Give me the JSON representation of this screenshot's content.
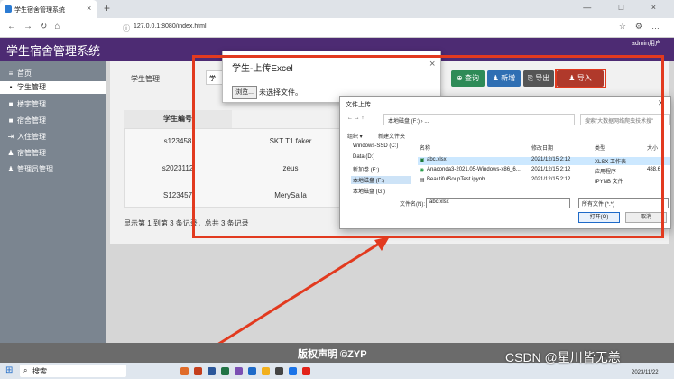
{
  "browser": {
    "tab_title": "学生宿舍管理系统",
    "tab_close": "×",
    "new_tab": "+",
    "url": "127.0.0.1:8080/index.html",
    "window_controls": "— □ ×"
  },
  "header": {
    "title": "学生宿舍管理系统",
    "user": "admin用户"
  },
  "sidebar": {
    "items": [
      {
        "icon": "≡",
        "label": "首页"
      },
      {
        "icon": "▪",
        "label": "学生管理"
      },
      {
        "icon": "■",
        "label": "楼宇管理"
      },
      {
        "icon": "■",
        "label": "宿舍管理"
      },
      {
        "icon": "⇥",
        "label": "入住管理"
      },
      {
        "icon": "♟",
        "label": "宿管管理"
      },
      {
        "icon": "♟",
        "label": "管理员管理"
      }
    ]
  },
  "main": {
    "filter_label": "学生管理",
    "filter_value": "学",
    "buttons": {
      "search": "查询",
      "add": "新增",
      "export": "导出",
      "import": "导入"
    },
    "table": {
      "header_number": "学生编号",
      "rows": [
        {
          "number": "s123458",
          "name": "SKT T1 faker"
        },
        {
          "number": "s2023112",
          "name": "zeus"
        },
        {
          "number": "S123457",
          "name": "MerySalla"
        }
      ]
    },
    "pagination": "显示第 1 到第 3 条记录，总共 3 条记录"
  },
  "upload_modal": {
    "title": "学生-上传Excel",
    "browse": "浏览...",
    "no_file": "未选择文件。",
    "close": "×"
  },
  "file_dialog": {
    "title": "文件上传",
    "path": "本地磁盘 (F:) › ...",
    "search_placeholder": "搜索\"大数据网络爬虫技术搜\"",
    "organize": "组织 ▾",
    "new_folder": "新建文件夹",
    "tree": [
      "Windows-SSD (C:)",
      "Data (D:)",
      "新加卷 (E:)",
      "本地磁盘 (F:)",
      "本地磁盘 (G:)"
    ],
    "columns": {
      "name": "名称",
      "date": "修改日期",
      "type": "类型",
      "size": "大小"
    },
    "files": [
      {
        "name": "abc.xlsx",
        "date": "2021/12/15 2:12",
        "type": "XLSX 工作表",
        "size": ""
      },
      {
        "name": "Anaconda3-2021.05-Windows-x86_6...",
        "date": "2021/12/15 2:12",
        "type": "应用程序",
        "size": "488,6"
      },
      {
        "name": "BeautifulSoupTest.ipynb",
        "date": "2021/12/15 2:12",
        "type": "IPYNB 文件",
        "size": ""
      }
    ],
    "filename_label": "文件名(N):",
    "filename_value": "abc.xlsx",
    "filetype_value": "所有文件 (*.*)",
    "open": "打开(O)",
    "cancel": "取消"
  },
  "footer": {
    "text": "版权声明 ©ZYP"
  },
  "taskbar": {
    "search": "搜索",
    "clock": "2023/11/22"
  },
  "watermark": "CSDN @星川皆无恙",
  "colors": {
    "header": "#4d2b73",
    "annotation": "#e23a1f",
    "import_button": "#b0392b"
  }
}
